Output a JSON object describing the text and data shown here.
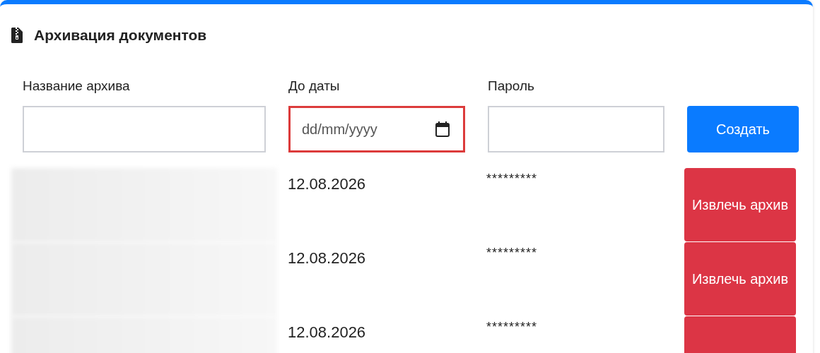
{
  "card": {
    "title": "Архивация документов"
  },
  "form": {
    "fields": [
      {
        "kind": "text",
        "label": "Название архива",
        "invalid": false
      },
      {
        "kind": "date",
        "label": "До даты",
        "placeholder": "dd/mm/yyyy",
        "invalid": true
      },
      {
        "kind": "password",
        "label": "Пароль",
        "invalid": false
      }
    ],
    "submit": "Создать"
  },
  "archives": [
    {
      "date": "12.08.2026",
      "password": "*********",
      "action": "Извлечь архив"
    },
    {
      "date": "12.08.2026",
      "password": "*********",
      "action": "Извлечь архив"
    },
    {
      "date": "12.08.2026",
      "password": "*********"
    }
  ]
}
